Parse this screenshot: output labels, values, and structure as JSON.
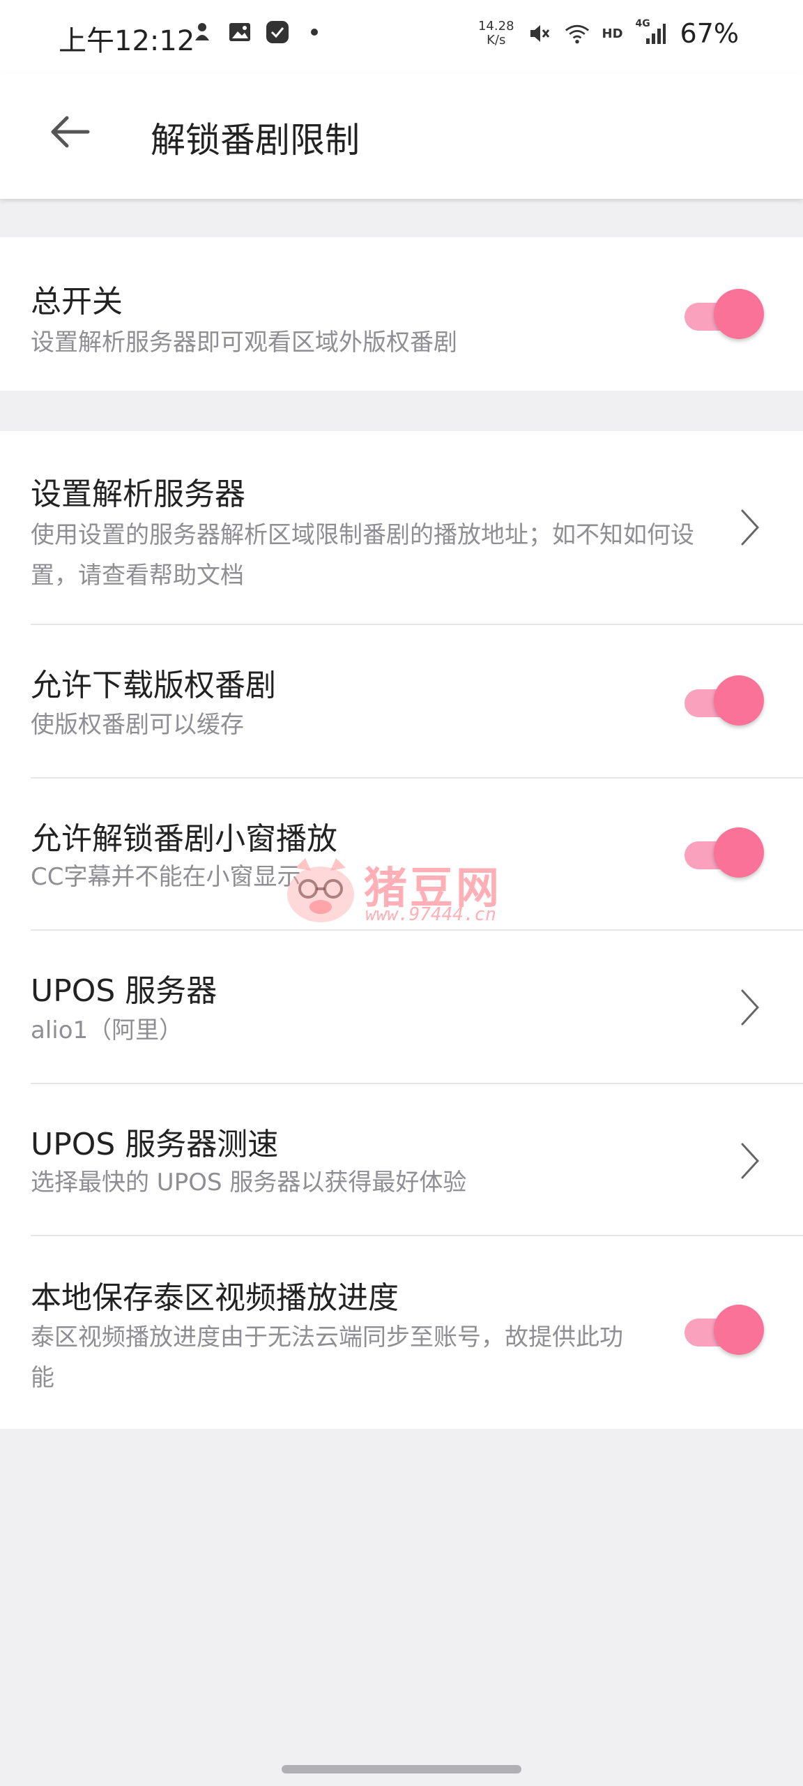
{
  "status_bar": {
    "time": "上午12:12",
    "net_speed_value": "14.28",
    "net_speed_unit": "K/s",
    "network_type": "4G",
    "hd_label": "HD",
    "battery": "67%"
  },
  "app_bar": {
    "title": "解锁番剧限制",
    "back_icon": "arrow-left-icon"
  },
  "main_switch": {
    "title": "总开关",
    "subtitle": "设置解析服务器即可观看区域外版权番剧",
    "enabled": true
  },
  "settings": [
    {
      "title": "设置解析服务器",
      "subtitle": "使用设置的服务器解析区域限制番剧的播放地址；如不知如何设置，请查看帮助文档",
      "control": "chevron"
    },
    {
      "title": "允许下载版权番剧",
      "subtitle": "使版权番剧可以缓存",
      "control": "toggle",
      "enabled": true
    },
    {
      "title": "允许解锁番剧小窗播放",
      "subtitle": "CC字幕并不能在小窗显示",
      "control": "toggle",
      "enabled": true
    },
    {
      "title": "UPOS 服务器",
      "subtitle": "alio1（阿里）",
      "control": "chevron"
    },
    {
      "title": "UPOS 服务器测速",
      "subtitle": "选择最快的 UPOS 服务器以获得最好体验",
      "control": "chevron"
    },
    {
      "title": "本地保存泰区视频播放进度",
      "subtitle": "泰区视频播放进度由于无法云端同步至账号，故提供此功能",
      "control": "toggle",
      "enabled": true
    }
  ],
  "watermark": {
    "text": "猪豆网",
    "url": "www.97444.cn"
  },
  "colors": {
    "accent": "#fb7299",
    "track": "#f9a1bd",
    "background": "#f0f0f2"
  }
}
